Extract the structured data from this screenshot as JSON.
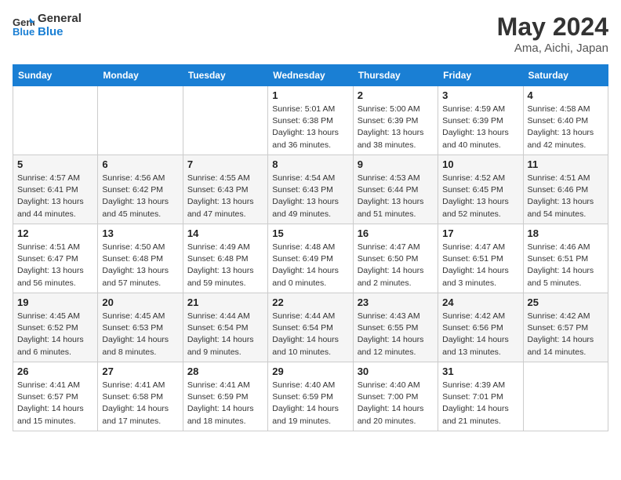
{
  "header": {
    "logo_line1": "General",
    "logo_line2": "Blue",
    "month_year": "May 2024",
    "location": "Ama, Aichi, Japan"
  },
  "days_of_week": [
    "Sunday",
    "Monday",
    "Tuesday",
    "Wednesday",
    "Thursday",
    "Friday",
    "Saturday"
  ],
  "weeks": [
    [
      {
        "day": "",
        "info": ""
      },
      {
        "day": "",
        "info": ""
      },
      {
        "day": "",
        "info": ""
      },
      {
        "day": "1",
        "info": "Sunrise: 5:01 AM\nSunset: 6:38 PM\nDaylight: 13 hours\nand 36 minutes."
      },
      {
        "day": "2",
        "info": "Sunrise: 5:00 AM\nSunset: 6:39 PM\nDaylight: 13 hours\nand 38 minutes."
      },
      {
        "day": "3",
        "info": "Sunrise: 4:59 AM\nSunset: 6:39 PM\nDaylight: 13 hours\nand 40 minutes."
      },
      {
        "day": "4",
        "info": "Sunrise: 4:58 AM\nSunset: 6:40 PM\nDaylight: 13 hours\nand 42 minutes."
      }
    ],
    [
      {
        "day": "5",
        "info": "Sunrise: 4:57 AM\nSunset: 6:41 PM\nDaylight: 13 hours\nand 44 minutes."
      },
      {
        "day": "6",
        "info": "Sunrise: 4:56 AM\nSunset: 6:42 PM\nDaylight: 13 hours\nand 45 minutes."
      },
      {
        "day": "7",
        "info": "Sunrise: 4:55 AM\nSunset: 6:43 PM\nDaylight: 13 hours\nand 47 minutes."
      },
      {
        "day": "8",
        "info": "Sunrise: 4:54 AM\nSunset: 6:43 PM\nDaylight: 13 hours\nand 49 minutes."
      },
      {
        "day": "9",
        "info": "Sunrise: 4:53 AM\nSunset: 6:44 PM\nDaylight: 13 hours\nand 51 minutes."
      },
      {
        "day": "10",
        "info": "Sunrise: 4:52 AM\nSunset: 6:45 PM\nDaylight: 13 hours\nand 52 minutes."
      },
      {
        "day": "11",
        "info": "Sunrise: 4:51 AM\nSunset: 6:46 PM\nDaylight: 13 hours\nand 54 minutes."
      }
    ],
    [
      {
        "day": "12",
        "info": "Sunrise: 4:51 AM\nSunset: 6:47 PM\nDaylight: 13 hours\nand 56 minutes."
      },
      {
        "day": "13",
        "info": "Sunrise: 4:50 AM\nSunset: 6:48 PM\nDaylight: 13 hours\nand 57 minutes."
      },
      {
        "day": "14",
        "info": "Sunrise: 4:49 AM\nSunset: 6:48 PM\nDaylight: 13 hours\nand 59 minutes."
      },
      {
        "day": "15",
        "info": "Sunrise: 4:48 AM\nSunset: 6:49 PM\nDaylight: 14 hours\nand 0 minutes."
      },
      {
        "day": "16",
        "info": "Sunrise: 4:47 AM\nSunset: 6:50 PM\nDaylight: 14 hours\nand 2 minutes."
      },
      {
        "day": "17",
        "info": "Sunrise: 4:47 AM\nSunset: 6:51 PM\nDaylight: 14 hours\nand 3 minutes."
      },
      {
        "day": "18",
        "info": "Sunrise: 4:46 AM\nSunset: 6:51 PM\nDaylight: 14 hours\nand 5 minutes."
      }
    ],
    [
      {
        "day": "19",
        "info": "Sunrise: 4:45 AM\nSunset: 6:52 PM\nDaylight: 14 hours\nand 6 minutes."
      },
      {
        "day": "20",
        "info": "Sunrise: 4:45 AM\nSunset: 6:53 PM\nDaylight: 14 hours\nand 8 minutes."
      },
      {
        "day": "21",
        "info": "Sunrise: 4:44 AM\nSunset: 6:54 PM\nDaylight: 14 hours\nand 9 minutes."
      },
      {
        "day": "22",
        "info": "Sunrise: 4:44 AM\nSunset: 6:54 PM\nDaylight: 14 hours\nand 10 minutes."
      },
      {
        "day": "23",
        "info": "Sunrise: 4:43 AM\nSunset: 6:55 PM\nDaylight: 14 hours\nand 12 minutes."
      },
      {
        "day": "24",
        "info": "Sunrise: 4:42 AM\nSunset: 6:56 PM\nDaylight: 14 hours\nand 13 minutes."
      },
      {
        "day": "25",
        "info": "Sunrise: 4:42 AM\nSunset: 6:57 PM\nDaylight: 14 hours\nand 14 minutes."
      }
    ],
    [
      {
        "day": "26",
        "info": "Sunrise: 4:41 AM\nSunset: 6:57 PM\nDaylight: 14 hours\nand 15 minutes."
      },
      {
        "day": "27",
        "info": "Sunrise: 4:41 AM\nSunset: 6:58 PM\nDaylight: 14 hours\nand 17 minutes."
      },
      {
        "day": "28",
        "info": "Sunrise: 4:41 AM\nSunset: 6:59 PM\nDaylight: 14 hours\nand 18 minutes."
      },
      {
        "day": "29",
        "info": "Sunrise: 4:40 AM\nSunset: 6:59 PM\nDaylight: 14 hours\nand 19 minutes."
      },
      {
        "day": "30",
        "info": "Sunrise: 4:40 AM\nSunset: 7:00 PM\nDaylight: 14 hours\nand 20 minutes."
      },
      {
        "day": "31",
        "info": "Sunrise: 4:39 AM\nSunset: 7:01 PM\nDaylight: 14 hours\nand 21 minutes."
      },
      {
        "day": "",
        "info": ""
      }
    ]
  ]
}
